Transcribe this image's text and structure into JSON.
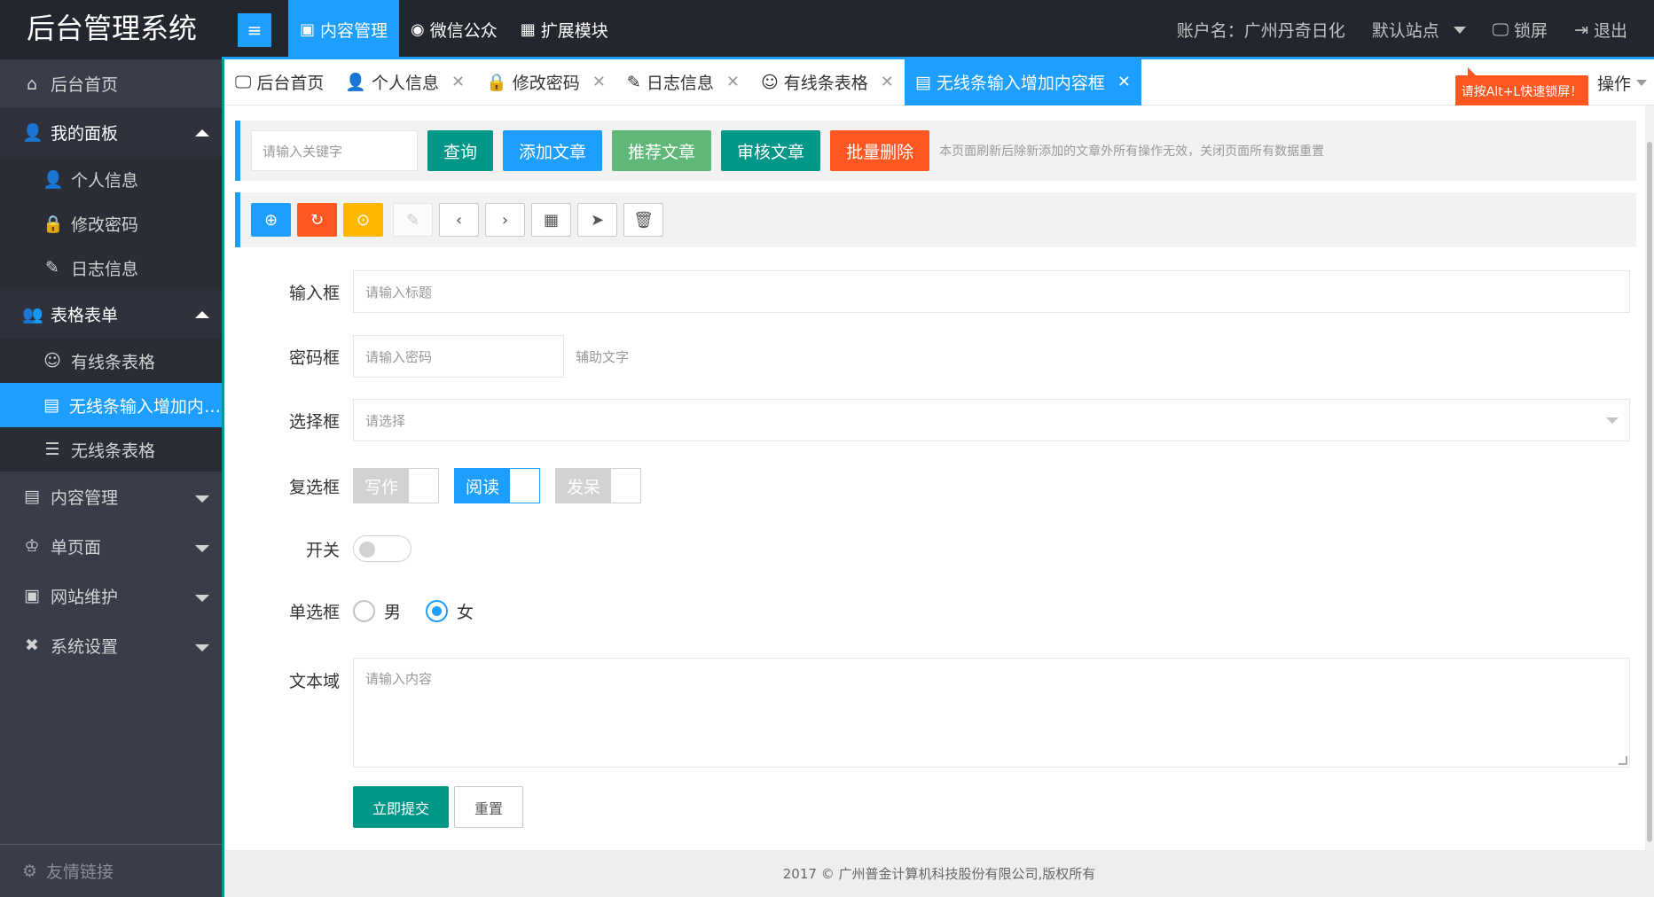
{
  "header": {
    "logo": "后台管理系统",
    "menu_toggle": "≡",
    "nav": [
      {
        "label": "内容管理",
        "icon": "📰"
      },
      {
        "label": "微信公众",
        "icon": "●"
      },
      {
        "label": "扩展模块",
        "icon": "▦"
      }
    ],
    "account": "账户名：广州丹奇日化",
    "site": "默认站点",
    "lock": "锁屏",
    "logout": "退出"
  },
  "sidebar": {
    "home": "后台首页",
    "my_panel": "我的面板",
    "my_panel_items": [
      "个人信息",
      "修改密码",
      "日志信息"
    ],
    "table_form": "表格表单",
    "table_form_items": [
      "有线条表格",
      "无线条输入增加内容框",
      "无线条表格"
    ],
    "content_mgmt": "内容管理",
    "single_page": "单页面",
    "site_maint": "网站维护",
    "sys_settings": "系统设置",
    "friend_links": "友情链接"
  },
  "tabs": [
    {
      "label": "后台首页",
      "closable": false
    },
    {
      "label": "个人信息",
      "closable": true
    },
    {
      "label": "修改密码",
      "closable": true
    },
    {
      "label": "日志信息",
      "closable": true
    },
    {
      "label": "有线条表格",
      "closable": true
    },
    {
      "label": "无线条输入增加内容框",
      "closable": true,
      "active": true
    }
  ],
  "tab_ops": "操作",
  "tooltip": "请按Alt+L快速锁屏！",
  "search": {
    "placeholder": "请输入关键字",
    "buttons": [
      "查询",
      "添加文章",
      "推荐文章",
      "审核文章",
      "批量删除"
    ],
    "note": "本页面刷新后除新添加的文章外所有操作无效，关闭页面所有数据重置"
  },
  "form": {
    "input_label": "输入框",
    "input_placeholder": "请输入标题",
    "password_label": "密码框",
    "password_placeholder": "请输入密码",
    "aux_text": "辅助文字",
    "select_label": "选择框",
    "select_placeholder": "请选择",
    "checkbox_label": "复选框",
    "checkboxes": [
      {
        "label": "写作",
        "checked": false
      },
      {
        "label": "阅读",
        "checked": true
      },
      {
        "label": "发呆",
        "checked": false
      }
    ],
    "switch_label": "开关",
    "switch_on": false,
    "radio_label": "单选框",
    "radios": [
      {
        "label": "男",
        "checked": false
      },
      {
        "label": "女",
        "checked": true
      }
    ],
    "textarea_label": "文本域",
    "textarea_placeholder": "请输入内容",
    "submit": "立即提交",
    "reset": "重置"
  },
  "footer": "2017 © 广州普金计算机科技股份有限公司,版权所有",
  "colors": {
    "accent": "#1e9fff",
    "teal": "#009688",
    "green": "#5fb878",
    "danger": "#ff5722",
    "warn": "#ffb800",
    "header_bg": "#23262e",
    "sidebar_bg": "#393d49"
  }
}
